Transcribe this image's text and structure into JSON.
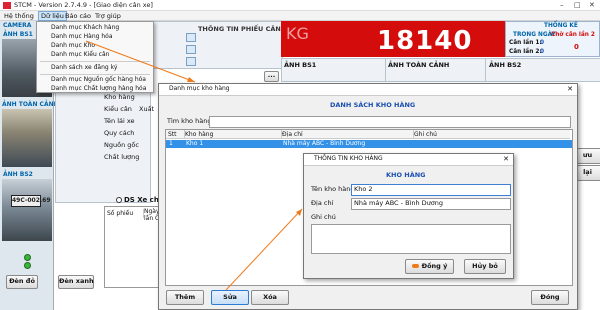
{
  "app": {
    "title": "STCM - Version 2.7.4.9 - [Giao diện cân xe]",
    "controls": [
      "–",
      "□",
      "✕"
    ]
  },
  "menu": [
    "Hệ thống",
    "Dữ liệu",
    "Báo cáo",
    "Trợ giúp"
  ],
  "dropdown": [
    "Danh mục Khách hàng",
    "Danh mục Hàng hóa",
    "Danh mục Kho",
    "Danh mục Kiểu cân",
    "Danh sách xe đăng ký",
    "Danh mục Nguồn gốc hàng hóa",
    "Danh mục Chất lượng hàng hóa"
  ],
  "left": {
    "camera": "CAMERA",
    "bs1": "ẢNH BS1",
    "toan_canh": "ẢNH TOÀN CẢNH",
    "bs2": "ẢNH BS2",
    "plate": "49C-002.69",
    "btn_red": "Đèn đỏ",
    "btn_green": "Đèn xanh"
  },
  "form_labels": {
    "kho_hang": "Kho hàng",
    "kieu_can": "Kiểu cân",
    "xuat": "Xuất",
    "ten_lai_xe": "Tên lái xe",
    "quy_cach": "Quy cách",
    "nguon_goc": "Nguồn gốc",
    "chat_luong": "Chất lượng"
  },
  "header": {
    "thong_tin_phieu_can": "THÔNG TIN PHIẾU CÂN",
    "ellipsis": "...",
    "ds_xe": "DS Xe ch",
    "so_phieu": "Số phiếu",
    "ngay": "Ngày",
    "lan_c": "lần C"
  },
  "scale": {
    "unit": "KG",
    "value": "18140"
  },
  "stats": {
    "title": "THỐNG KÊ",
    "trong_ngay": "TRONG NGÀY",
    "can_lan_1": "Cân lần 1:",
    "can_lan_1_val": "0",
    "can_lan_2": "Cân lần 2:",
    "can_lan_2_val": "0",
    "cho_can": "Chờ cân lần 2",
    "cho_can_val": "0"
  },
  "images": {
    "bs1": "ẢNH BS1",
    "toan_canh": "ẢNH TOÀN CẢNH",
    "bs2": "ẢNH BS2"
  },
  "right_buttons": [
    "ưu",
    "lại"
  ],
  "kho_window": {
    "title": "Danh mục kho hàng",
    "heading": "DANH SÁCH KHO HÀNG",
    "search_label": "Tìm kho hàng",
    "columns": [
      "Stt",
      "Kho hàng",
      "Địa chỉ",
      "Ghi chú"
    ],
    "rows": [
      {
        "stt": "1",
        "kho": "Kho 1",
        "dia_chi": "Nhà máy ABC - Bình Dương",
        "ghi_chu": ""
      }
    ],
    "buttons": {
      "them": "Thêm",
      "sua": "Sửa",
      "xoa": "Xóa",
      "dong": "Đóng"
    }
  },
  "info_window": {
    "title": "THÔNG TIN KHO HÀNG",
    "heading": "KHO HÀNG",
    "ten_label": "Tên kho hàng",
    "ten_value": "Kho 2",
    "dia_chi_label": "Địa chỉ",
    "dia_chi_value": "Nhà máy ABC - Bình Dương",
    "ghi_chu_label": "Ghi chú",
    "ghi_chu_value": "",
    "btn_ok": "Đồng ý",
    "btn_cancel": "Hủy bỏ"
  },
  "colors": {
    "accent_blue": "#1a4fb0",
    "scale_red": "#d40c0c",
    "selection": "#3391e8",
    "arrow": "#f07a1a"
  }
}
